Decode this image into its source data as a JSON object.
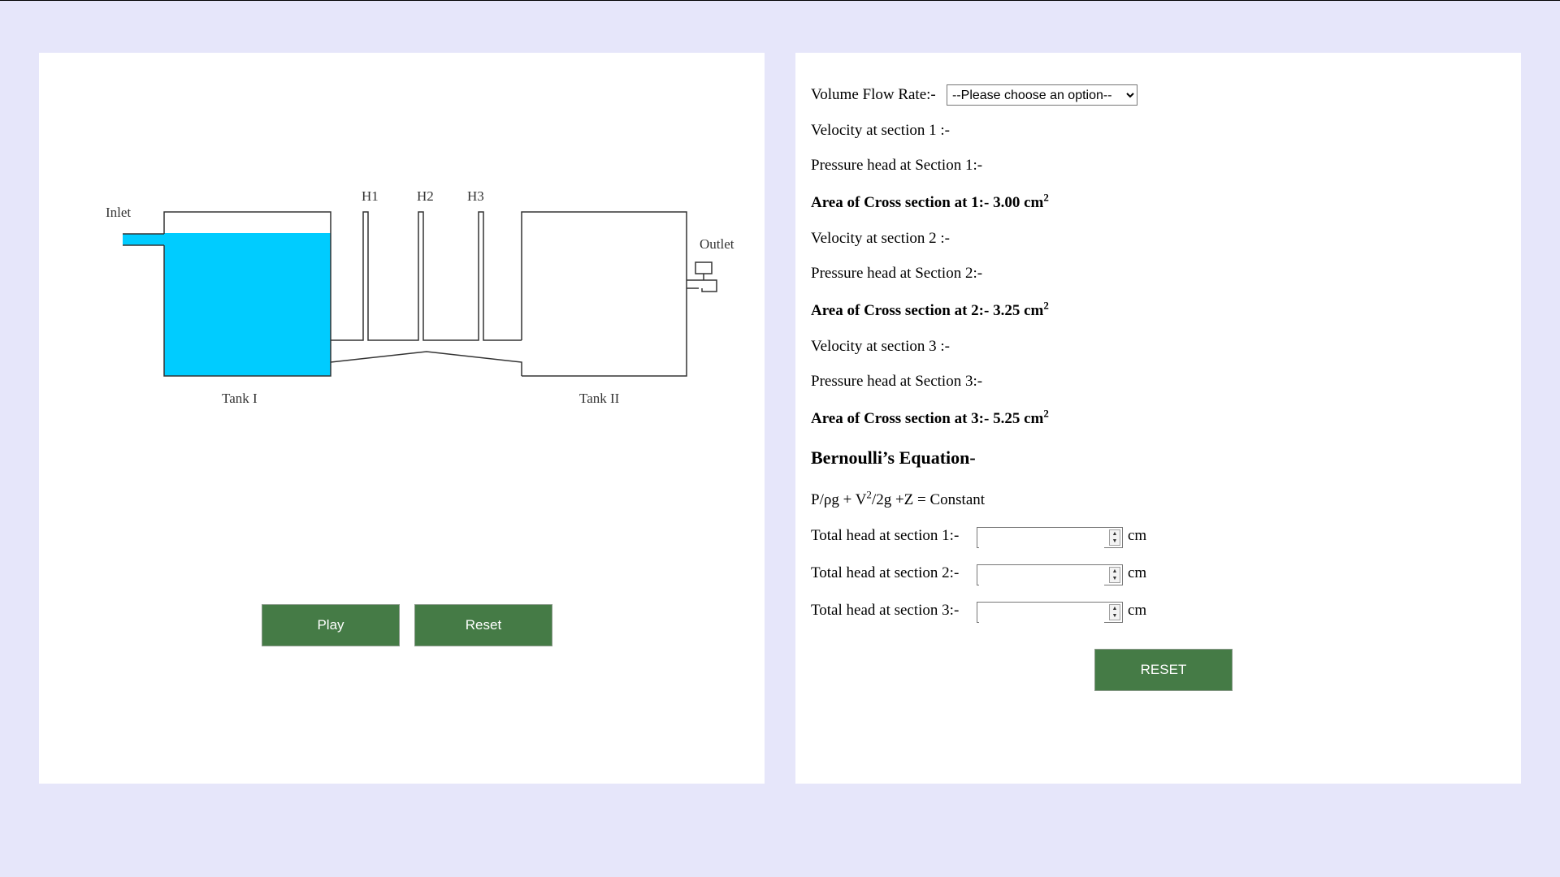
{
  "simulation": {
    "labels": {
      "inlet": "Inlet",
      "outlet": "Outlet",
      "h1": "H1",
      "h2": "H2",
      "h3": "H3",
      "tank1": "Tank I",
      "tank2": "Tank II"
    },
    "water_color": "#00ccff",
    "buttons": {
      "play": "Play",
      "reset": "Reset"
    },
    "button_color": "#457b46"
  },
  "calc": {
    "flow_rate_label": "Volume Flow Rate:-",
    "flow_rate_placeholder": "--Please choose an option--",
    "velocity1": "Velocity at section 1 :-",
    "pressure1": "Pressure head at Section 1:-",
    "area1": "Area of Cross section at 1:- 3.00 cm",
    "velocity2": "Velocity at section 2 :-",
    "pressure2": "Pressure head at Section 2:-",
    "area2": "Area of Cross section at 2:- 3.25 cm",
    "velocity3": "Velocity at section 3 :-",
    "pressure3": "Pressure head at Section 3:-",
    "area3": "Area of Cross section at 3:- 5.25 cm",
    "area_exponent": "2",
    "equation_heading": "Bernoulli’s Equation-",
    "equation_pre": "P/ρg + V",
    "equation_exp": "2",
    "equation_post": "/2g +Z = Constant",
    "total1": "Total head at section 1:-",
    "total2": "Total head at section 2:-",
    "total3": "Total head at section 3:-",
    "total1_value": "",
    "total2_value": "",
    "total3_value": "",
    "unit": "cm",
    "reset_label": "RESET"
  }
}
